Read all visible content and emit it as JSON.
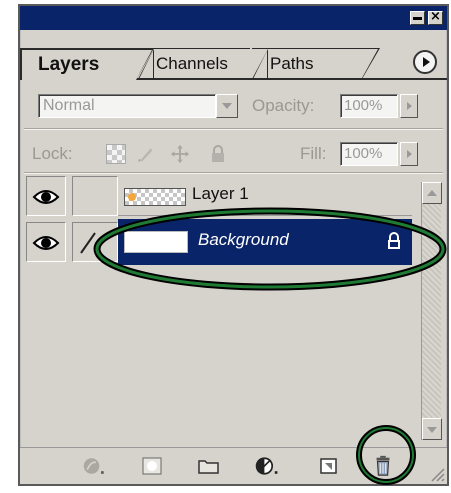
{
  "tabs": [
    {
      "label": "Layers"
    },
    {
      "label": "Channels"
    },
    {
      "label": "Paths"
    }
  ],
  "blend": {
    "mode": "Normal",
    "opacity_label": "Opacity:",
    "opacity_value": "100%"
  },
  "lock": {
    "label": "Lock:",
    "fill_label": "Fill:",
    "fill_value": "100%"
  },
  "layers": [
    {
      "name": "Layer 1",
      "selected": false,
      "visible": true
    },
    {
      "name": "Background",
      "selected": true,
      "visible": true,
      "locked": true
    }
  ],
  "colors": {
    "accent": "#0a246a",
    "highlight": "#0e6b2a",
    "panel_bg": "#d6d3cc"
  },
  "bottom_icons": [
    "layer-style-icon",
    "layer-mask-icon",
    "new-set-icon",
    "adjustment-layer-icon",
    "new-layer-icon",
    "delete-layer-icon"
  ]
}
